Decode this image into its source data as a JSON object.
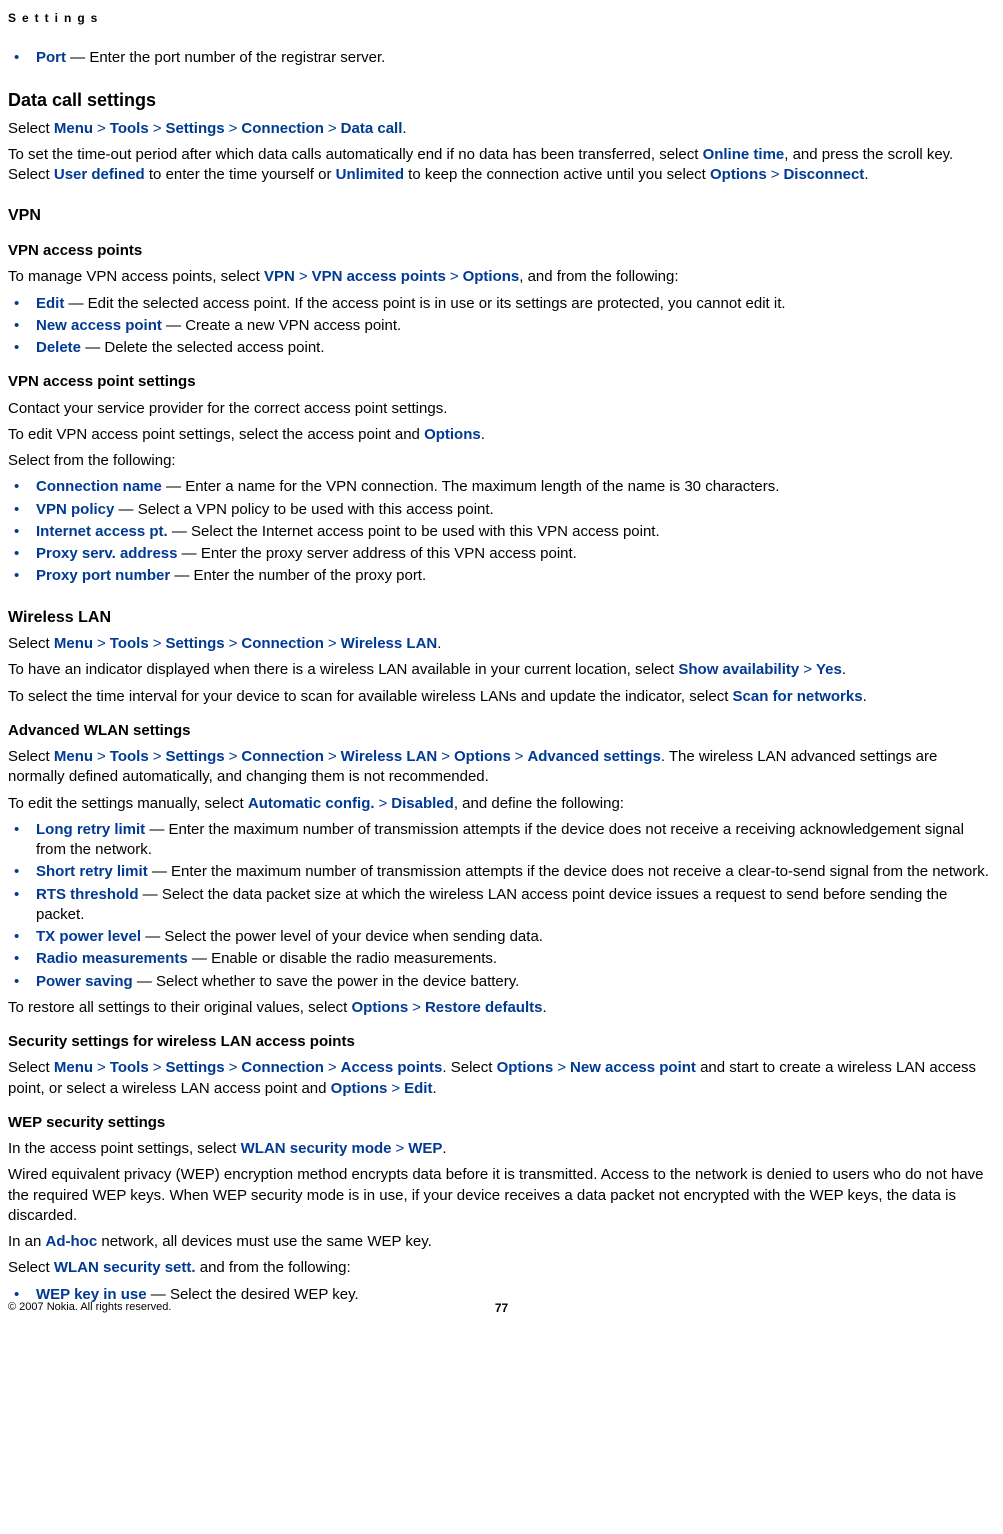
{
  "header": {
    "title": "Settings"
  },
  "port_bullet": {
    "term": "Port",
    "desc": " — Enter the port number of the registrar server."
  },
  "data_call": {
    "heading": "Data call settings",
    "select_prefix": "Select ",
    "path": [
      "Menu",
      "Tools",
      "Settings",
      "Connection",
      "Data call"
    ],
    "p2_a": "To set the time-out period after which data calls automatically end if no data has been transferred, select ",
    "online_time": "Online time",
    "p2_b": ", and press the scroll key. Select ",
    "user_defined": "User defined",
    "p2_c": " to enter the time yourself or ",
    "unlimited": "Unlimited",
    "p2_d": " to keep the connection active until you select ",
    "options": "Options",
    "disconnect": "Disconnect",
    "period": "."
  },
  "vpn": {
    "heading": "VPN",
    "ap_heading": "VPN access points",
    "p1_a": "To manage VPN access points, select ",
    "vpn_b": "VPN",
    "vpn_ap": "VPN access points",
    "options": "Options",
    "p1_b": ", and from the following:",
    "bullets": [
      {
        "term": "Edit",
        "desc": " — Edit the selected access point. If the access point is in use or its settings are protected, you cannot edit it."
      },
      {
        "term": "New access point",
        "desc": " — Create a new VPN access point."
      },
      {
        "term": "Delete",
        "desc": " — Delete the selected access point."
      }
    ],
    "ap_set_heading": "VPN access point settings",
    "p2": "Contact your service provider for the correct access point settings.",
    "p3_a": "To edit VPN access point settings, select the access point and ",
    "p3_b": ".",
    "p4": "Select from the following:",
    "bullets2": [
      {
        "term": "Connection name",
        "desc": " — Enter a name for the VPN connection. The maximum length of the name is 30 characters."
      },
      {
        "term": "VPN policy",
        "desc": " — Select a VPN policy to be used with this access point."
      },
      {
        "term": "Internet access pt.",
        "desc": " — Select the Internet access point to be used with this VPN access point."
      },
      {
        "term": "Proxy serv. address",
        "desc": " — Enter the proxy server address of this VPN access point."
      },
      {
        "term": "Proxy port number",
        "desc": " — Enter the number of the proxy port."
      }
    ]
  },
  "wlan": {
    "heading": "Wireless LAN",
    "select_prefix": "Select ",
    "path": [
      "Menu",
      "Tools",
      "Settings",
      "Connection",
      "Wireless LAN"
    ],
    "p2_a": "To have an indicator displayed when there is a wireless LAN available in your current location, select ",
    "show_avail": "Show availability",
    "yes": "Yes",
    "p2_b": ".",
    "p3_a": "To select the time interval for your device to scan for available wireless LANs and update the indicator, select ",
    "scan_for_networks": "Scan for networks",
    "p3_b": ".",
    "adv_heading": "Advanced WLAN settings",
    "adv_p1_a": "Select ",
    "adv_path": [
      "Menu",
      "Tools",
      "Settings",
      "Connection",
      "Wireless LAN",
      "Options",
      "Advanced settings"
    ],
    "adv_p1_b": ". The wireless LAN advanced settings are normally defined automatically, and changing them is not recommended.",
    "adv_p2_a": "To edit the settings manually, select ",
    "auto_config": "Automatic config.",
    "disabled": "Disabled",
    "adv_p2_b": ", and define the following:",
    "adv_bullets": [
      {
        "term": "Long retry limit",
        "desc": " — Enter the maximum number of transmission attempts if the device does not receive a receiving acknowledgement signal from the network."
      },
      {
        "term": "Short retry limit",
        "desc": " — Enter the maximum number of transmission attempts if the device does not receive a clear-to-send signal from the network."
      },
      {
        "term": "RTS threshold",
        "desc": " — Select the data packet size at which the wireless LAN access point device issues a request to send before sending the packet."
      },
      {
        "term": "TX power level",
        "desc": " — Select the power level of your device when sending data."
      },
      {
        "term": "Radio measurements",
        "desc": " — Enable or disable the radio measurements."
      },
      {
        "term": "Power saving",
        "desc": " — Select whether to save the power in the device battery."
      }
    ],
    "restore_a": "To restore all settings to their original values, select ",
    "options": "Options",
    "restore_defaults": "Restore defaults",
    "restore_b": ".",
    "sec_heading": "Security settings for wireless LAN access points",
    "sec_p1_a": "Select ",
    "sec_path": [
      "Menu",
      "Tools",
      "Settings",
      "Connection",
      "Access points"
    ],
    "sec_p1_b": ". Select ",
    "new_ap": "New access point",
    "sec_p1_c": " and start to create a wireless LAN access point, or select a wireless LAN access point and ",
    "edit": "Edit",
    "sec_p1_d": ".",
    "wep_heading": "WEP security settings",
    "wep_p1_a": "In the access point settings, select ",
    "wlan_sec_mode": "WLAN security mode",
    "wep": "WEP",
    "wep_p1_b": ".",
    "wep_p2": "Wired equivalent privacy (WEP) encryption method encrypts data before it is transmitted. Access to the network is denied to users who do not have the required WEP keys. When WEP security mode is in use, if your device receives a data packet not encrypted with the WEP keys, the data is discarded.",
    "wep_p3_a": "In an ",
    "adhoc": "Ad-hoc",
    "wep_p3_b": " network, all devices must use the same WEP key.",
    "wep_p4_a": "Select ",
    "wlan_sec_sett": "WLAN security sett.",
    "wep_p4_b": " and from the following:",
    "wep_bullets": [
      {
        "term": "WEP key in use",
        "desc": " — Select the desired WEP key."
      }
    ]
  },
  "footer": {
    "copyright": "© 2007 Nokia. All rights reserved.",
    "page": "77"
  },
  "gt": ">"
}
